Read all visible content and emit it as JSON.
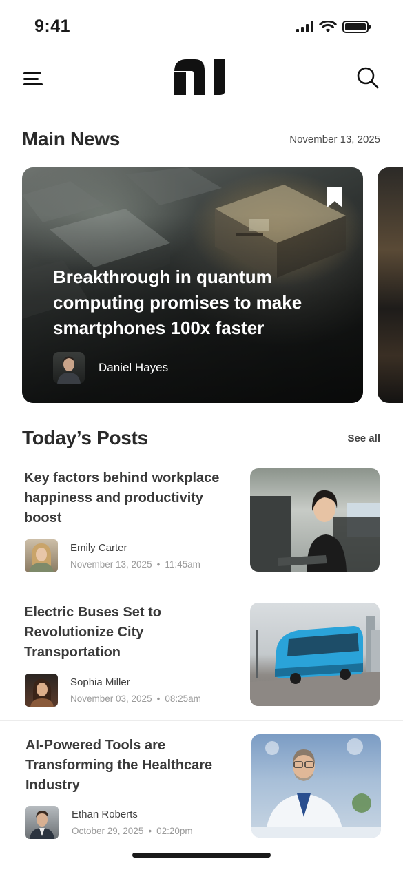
{
  "status_bar": {
    "time": "9:41"
  },
  "header": {
    "logo_text": "nl"
  },
  "main_news": {
    "title": "Main News",
    "date": "November 13, 2025",
    "featured": {
      "headline": "Breakthrough in quantum computing promises to make smartphones 100x faster",
      "author": "Daniel Hayes"
    }
  },
  "todays_posts": {
    "title": "Today’s Posts",
    "see_all": "See all",
    "posts": [
      {
        "title": "Key factors behind workplace happiness and productivity boost",
        "author": "Emily Carter",
        "date": "November 13, 2025",
        "time": "11:45am",
        "separator": "•"
      },
      {
        "title": "Electric Buses Set to Revolutionize City Transportation",
        "author": "Sophia Miller",
        "date": "November 03, 2025",
        "time": "08:25am",
        "separator": "•"
      },
      {
        "title": "AI-Powered Tools are Transforming the Healthcare Industry",
        "author": "Ethan Roberts",
        "date": "October 29, 2025",
        "time": "02:20pm",
        "separator": "•"
      }
    ]
  },
  "icons": {
    "menu": "menu-icon",
    "search": "search-icon",
    "bookmark": "bookmark-icon",
    "signal": "signal-icon",
    "wifi": "wifi-icon",
    "battery": "battery-icon"
  },
  "colors": {
    "text_primary": "#2b2b2b",
    "text_muted": "#9a9a9a",
    "divider": "#ececec",
    "bus_blue": "#2aa3d9"
  }
}
